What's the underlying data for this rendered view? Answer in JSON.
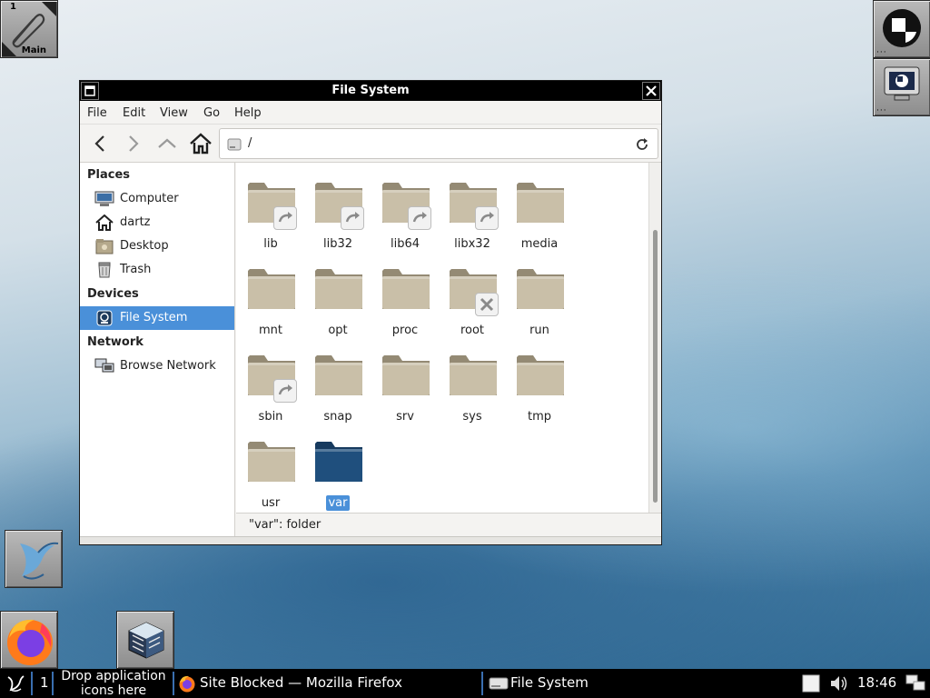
{
  "desktop": {
    "workspace_tile": {
      "number": "1",
      "label": "Main"
    }
  },
  "window": {
    "title": "File System",
    "menu": [
      "File",
      "Edit",
      "View",
      "Go",
      "Help"
    ],
    "path": "/",
    "sidebar": {
      "places_heading": "Places",
      "places": [
        "Computer",
        "dartz",
        "Desktop",
        "Trash"
      ],
      "devices_heading": "Devices",
      "devices": [
        "File System"
      ],
      "network_heading": "Network",
      "network": [
        "Browse Network"
      ]
    },
    "files": [
      {
        "name": "lib",
        "emblem": "symlink-arrow-icon"
      },
      {
        "name": "lib32",
        "emblem": "symlink-arrow-icon"
      },
      {
        "name": "lib64",
        "emblem": "symlink-arrow-icon"
      },
      {
        "name": "libx32",
        "emblem": "symlink-arrow-icon"
      },
      {
        "name": "media",
        "emblem": ""
      },
      {
        "name": "mnt",
        "emblem": ""
      },
      {
        "name": "opt",
        "emblem": ""
      },
      {
        "name": "proc",
        "emblem": ""
      },
      {
        "name": "root",
        "emblem": "no-access-x-icon"
      },
      {
        "name": "run",
        "emblem": ""
      },
      {
        "name": "sbin",
        "emblem": "symlink-arrow-icon"
      },
      {
        "name": "snap",
        "emblem": ""
      },
      {
        "name": "srv",
        "emblem": ""
      },
      {
        "name": "sys",
        "emblem": ""
      },
      {
        "name": "tmp",
        "emblem": ""
      },
      {
        "name": "usr",
        "emblem": ""
      },
      {
        "name": "var",
        "emblem": "",
        "selected": true
      }
    ],
    "status": "\"var\": folder"
  },
  "taskbar": {
    "workspace_number": "1",
    "drop_hint_line1": "Drop application",
    "drop_hint_line2": "icons here",
    "tasks": [
      "Site Blocked — Mozilla Firefox",
      "File System"
    ],
    "clock": "18:46"
  },
  "colors": {
    "selection": "#4a90d9",
    "folder": "#c9bfa8",
    "folder_selected": "#1f4f7d",
    "taskbar_bg": "#000000"
  }
}
